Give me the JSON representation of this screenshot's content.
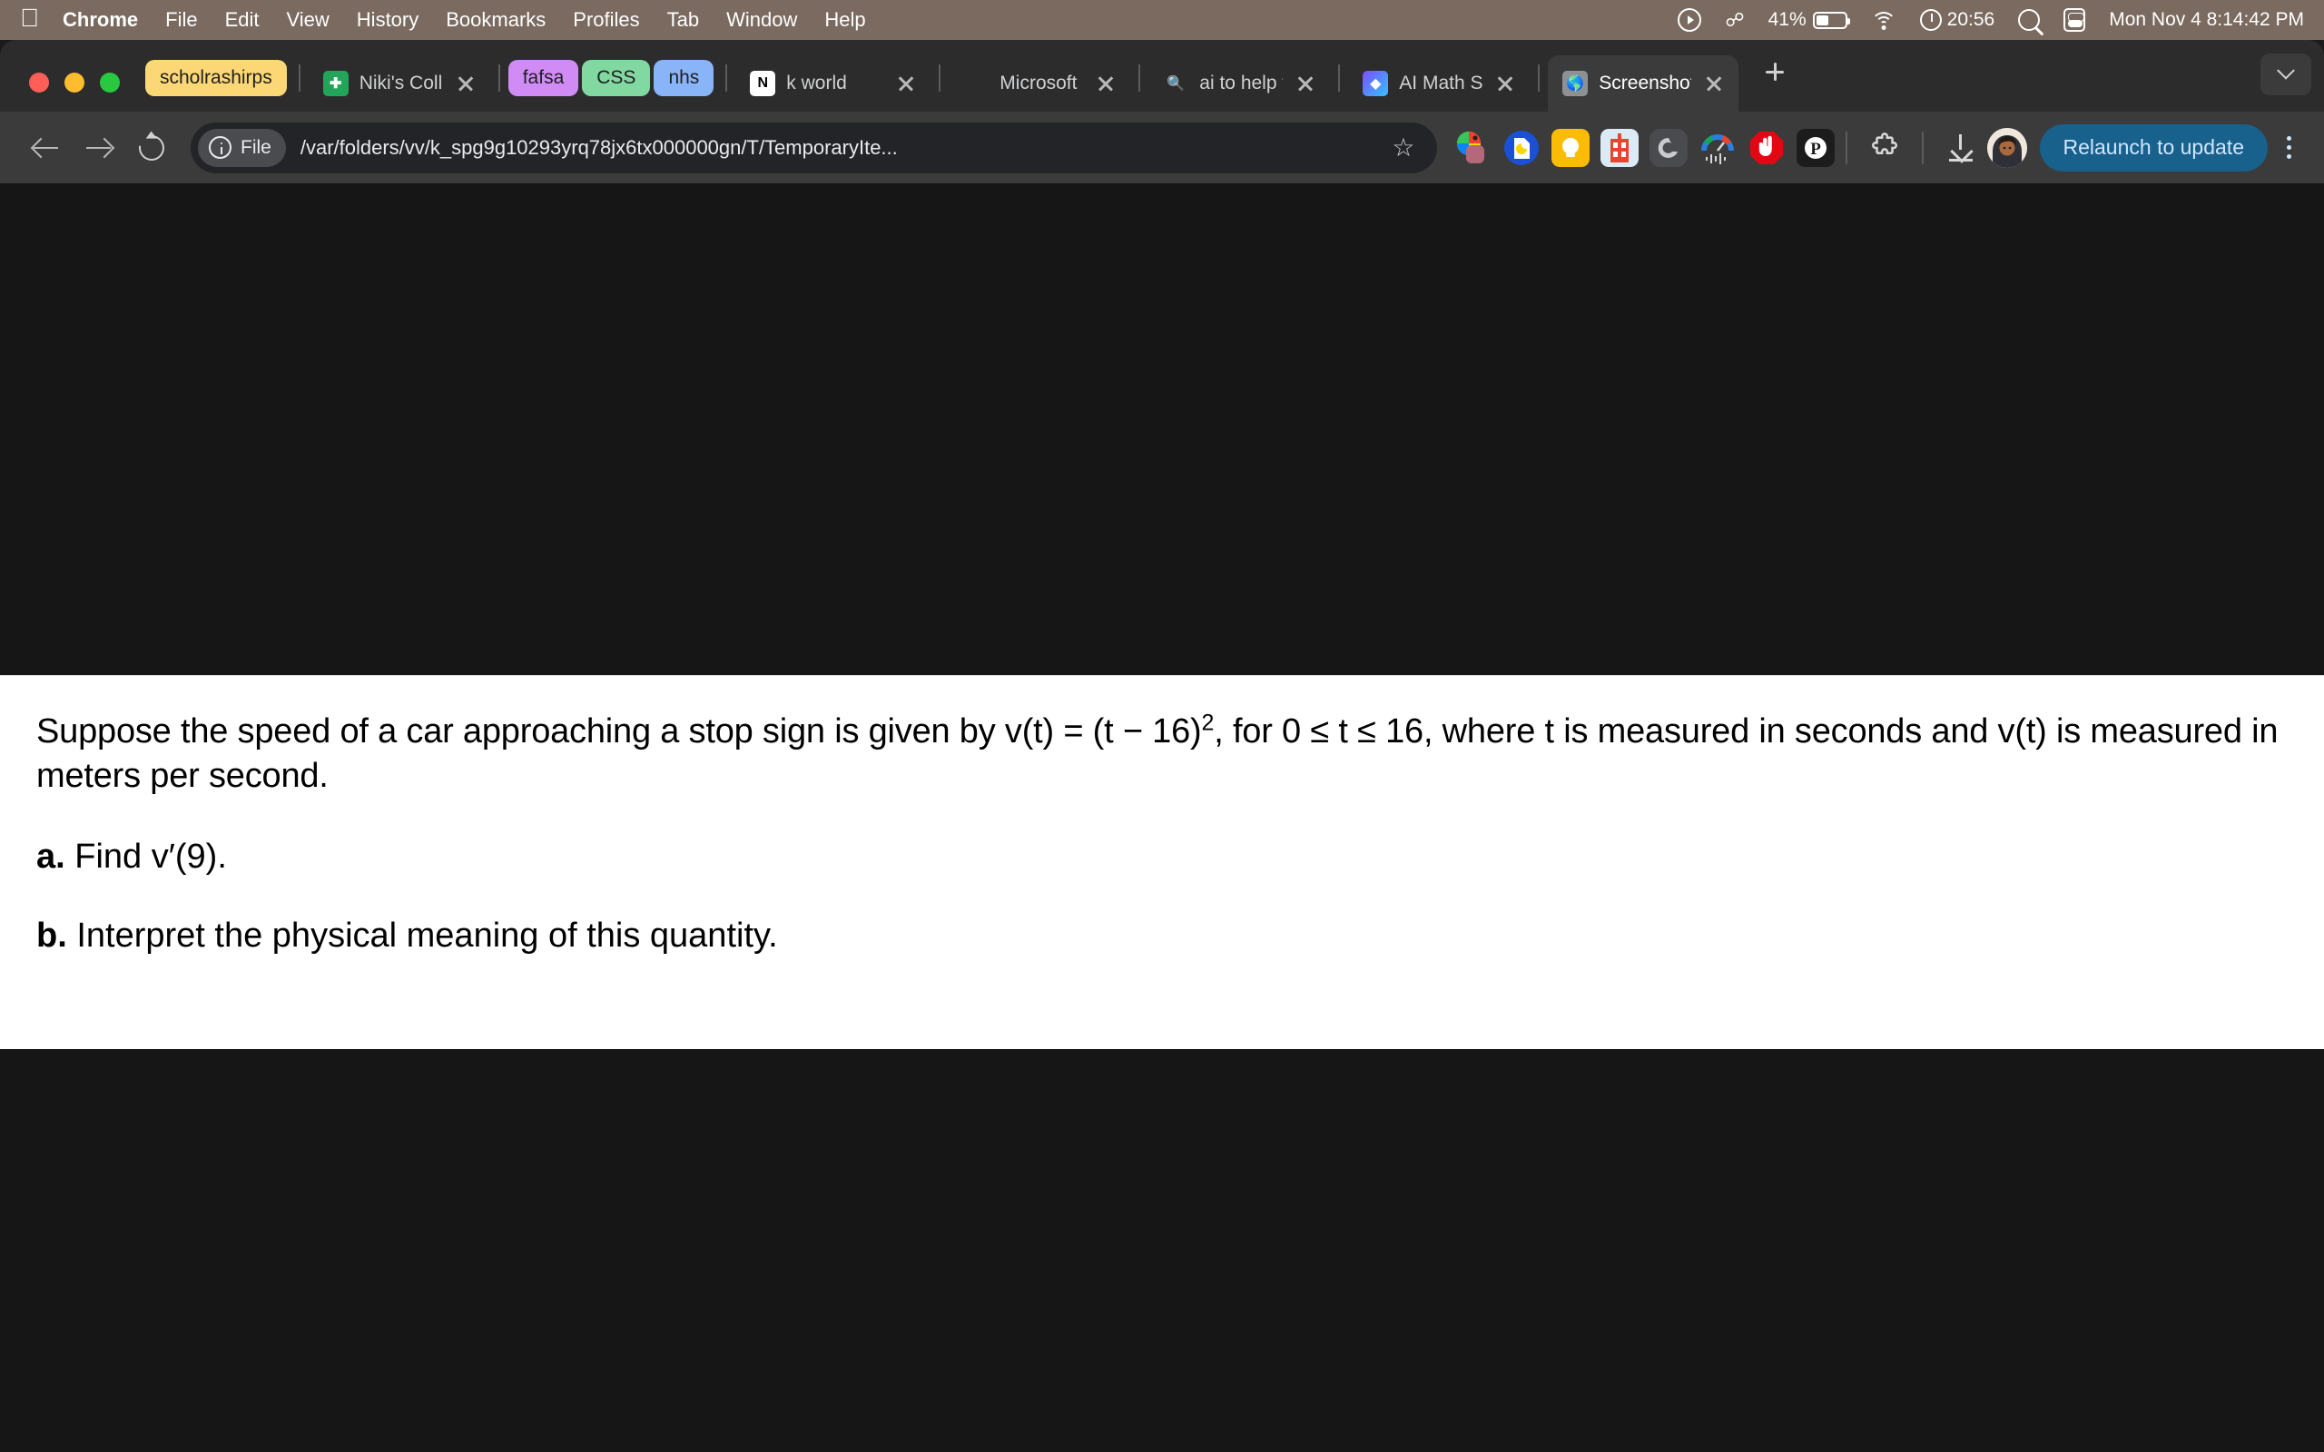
{
  "menubar": {
    "apple_glyph": "",
    "items": [
      "Chrome",
      "File",
      "Edit",
      "View",
      "History",
      "Bookmarks",
      "Profiles",
      "Tab",
      "Window",
      "Help"
    ],
    "status": {
      "battery_percent": "41%",
      "screen_time": "20:56",
      "datetime": "Mon Nov 4  8:14:42 PM"
    }
  },
  "tabstrip": {
    "groups": [
      {
        "label": "scholrashirps",
        "color": "#fcd775"
      },
      {
        "label": "fafsa",
        "color": "#d08bf5"
      },
      {
        "label": "CSS",
        "color": "#81d8a0"
      },
      {
        "label": "nhs",
        "color": "#89b4f8"
      }
    ],
    "tabs": [
      {
        "title": "Niki's College",
        "icon": "google-sheets-icon",
        "active": false
      },
      {
        "title": "k world",
        "icon": "notion-icon",
        "active": false
      },
      {
        "title": "Microsoft ac",
        "icon": "microsoft-icon",
        "active": false
      },
      {
        "title": "ai to help wi",
        "icon": "google-search-icon",
        "active": false
      },
      {
        "title": "AI Math Solv",
        "icon": "ai-math-solver-icon",
        "active": false
      },
      {
        "title": "Screenshot",
        "icon": "globe-icon",
        "active": true
      }
    ],
    "new_tab_label": "+",
    "tab_search_label": "v"
  },
  "toolbar": {
    "back_label": "Back",
    "forward_label": "Forward",
    "reload_label": "Reload",
    "scheme_label": "File",
    "url": "/var/folders/vv/k_spg9g10293yrq78jx6tx000000gn/T/TemporaryIte...",
    "bookmark_label": "☆",
    "extensions": [
      "color-picker-extension-icon",
      "document-reader-extension-icon",
      "lightbulb-notes-extension-icon",
      "building-extension-icon",
      "grammarly-extension-icon",
      "audio-meter-extension-icon",
      "adblock-extension-icon",
      "pinterest-extension-icon"
    ],
    "extensions_menu_label": "Extensions",
    "downloads_label": "Downloads",
    "profile_label": "Profile",
    "relaunch_label": "Relaunch to update",
    "menu_label": "Customize and control Google Chrome"
  },
  "page": {
    "problem_part1": "Suppose the speed of a car approaching a stop sign is given by v(t) = (t − 16)",
    "problem_exp": "2",
    "problem_part2": ", for 0 ≤ t ≤ 16, where t is measured in seconds and v(t) is measured in meters per second.",
    "question_a_marker": "a.",
    "question_a_text": "Find v′(9).",
    "question_b_marker": "b.",
    "question_b_text": "Interpret the physical meaning of this quantity."
  },
  "colors": {
    "menubar_bg": "#7a6a5f",
    "chrome_bg": "#2c2c2c",
    "toolbar_bg": "#3b3b3b",
    "omnibox_bg": "#232427",
    "relaunch_bg": "#17618c",
    "page_bg": "#161616"
  }
}
